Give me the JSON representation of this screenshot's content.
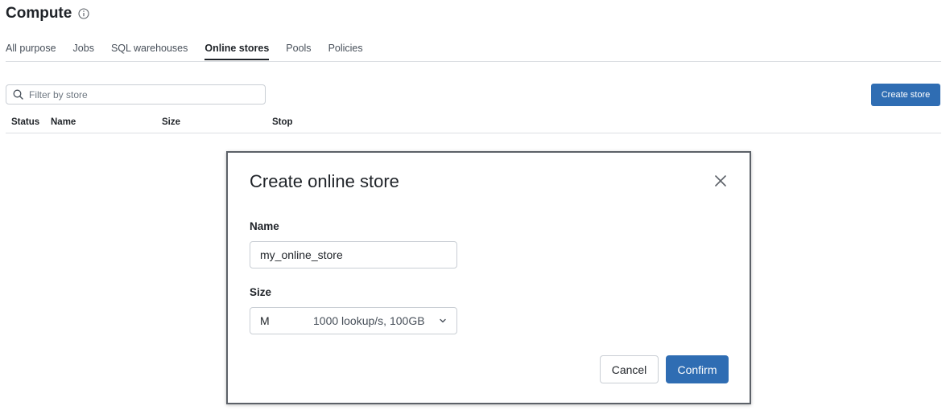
{
  "header": {
    "title": "Compute",
    "info_icon": "info-icon"
  },
  "tabs": [
    {
      "label": "All purpose",
      "active": false
    },
    {
      "label": "Jobs",
      "active": false
    },
    {
      "label": "SQL warehouses",
      "active": false
    },
    {
      "label": "Online stores",
      "active": true
    },
    {
      "label": "Pools",
      "active": false
    },
    {
      "label": "Policies",
      "active": false
    }
  ],
  "filter": {
    "placeholder": "Filter by store",
    "icon": "search-icon"
  },
  "create_store_button": "Create store",
  "table": {
    "columns": [
      "Status",
      "Name",
      "Size",
      "Stop"
    ]
  },
  "modal": {
    "title": "Create online store",
    "name_label": "Name",
    "name_value": "my_online_store",
    "size_label": "Size",
    "size_code": "M",
    "size_description": "1000 lookup/s, 100GB",
    "cancel_label": "Cancel",
    "confirm_label": "Confirm"
  },
  "colors": {
    "accent": "#2f6db3",
    "border": "#c9ced4",
    "modal_border": "#5c6168"
  }
}
